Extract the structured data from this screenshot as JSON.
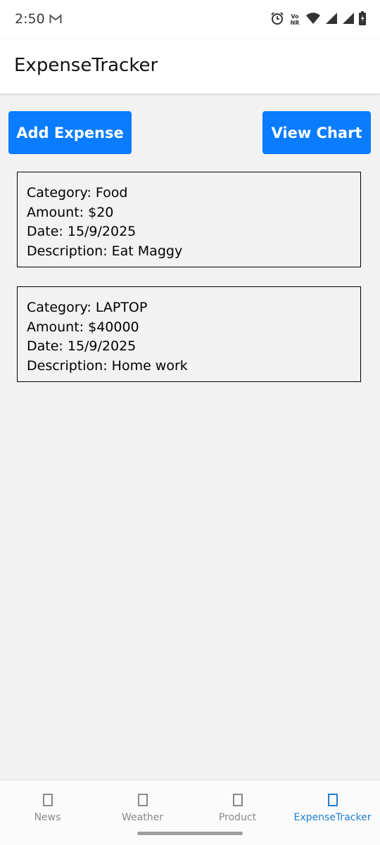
{
  "status_bar": {
    "time": "2:50",
    "volte_line1": "Vo",
    "volte_line2": "NR",
    "icons": [
      "gmail-icon",
      "alarm-icon",
      "volte-nr-icon",
      "wifi-icon",
      "cellular-signal-icon",
      "cellular-signal-icon",
      "battery-charging-icon"
    ]
  },
  "app_bar": {
    "title": "ExpenseTracker"
  },
  "actions": {
    "add_label": "Add Expense",
    "chart_label": "View Chart"
  },
  "expenses": [
    {
      "category": "Category: Food",
      "amount": "Amount: $20",
      "date": "Date: 15/9/2025",
      "description": "Description: Eat Maggy"
    },
    {
      "category": "Category: LAPTOP",
      "amount": "Amount: $40000",
      "date": "Date: 15/9/2025",
      "description": "Description: Home work"
    }
  ],
  "bottom_nav": {
    "items": [
      {
        "label": "News",
        "active": false
      },
      {
        "label": "Weather",
        "active": false
      },
      {
        "label": "Product",
        "active": false
      },
      {
        "label": "ExpenseTracker",
        "active": true
      }
    ]
  },
  "colors": {
    "primary_button": "#0a7cff",
    "active_tab": "#1e7fd0",
    "inactive_tab": "#8a8a8a",
    "background": "#f2f2f2"
  }
}
